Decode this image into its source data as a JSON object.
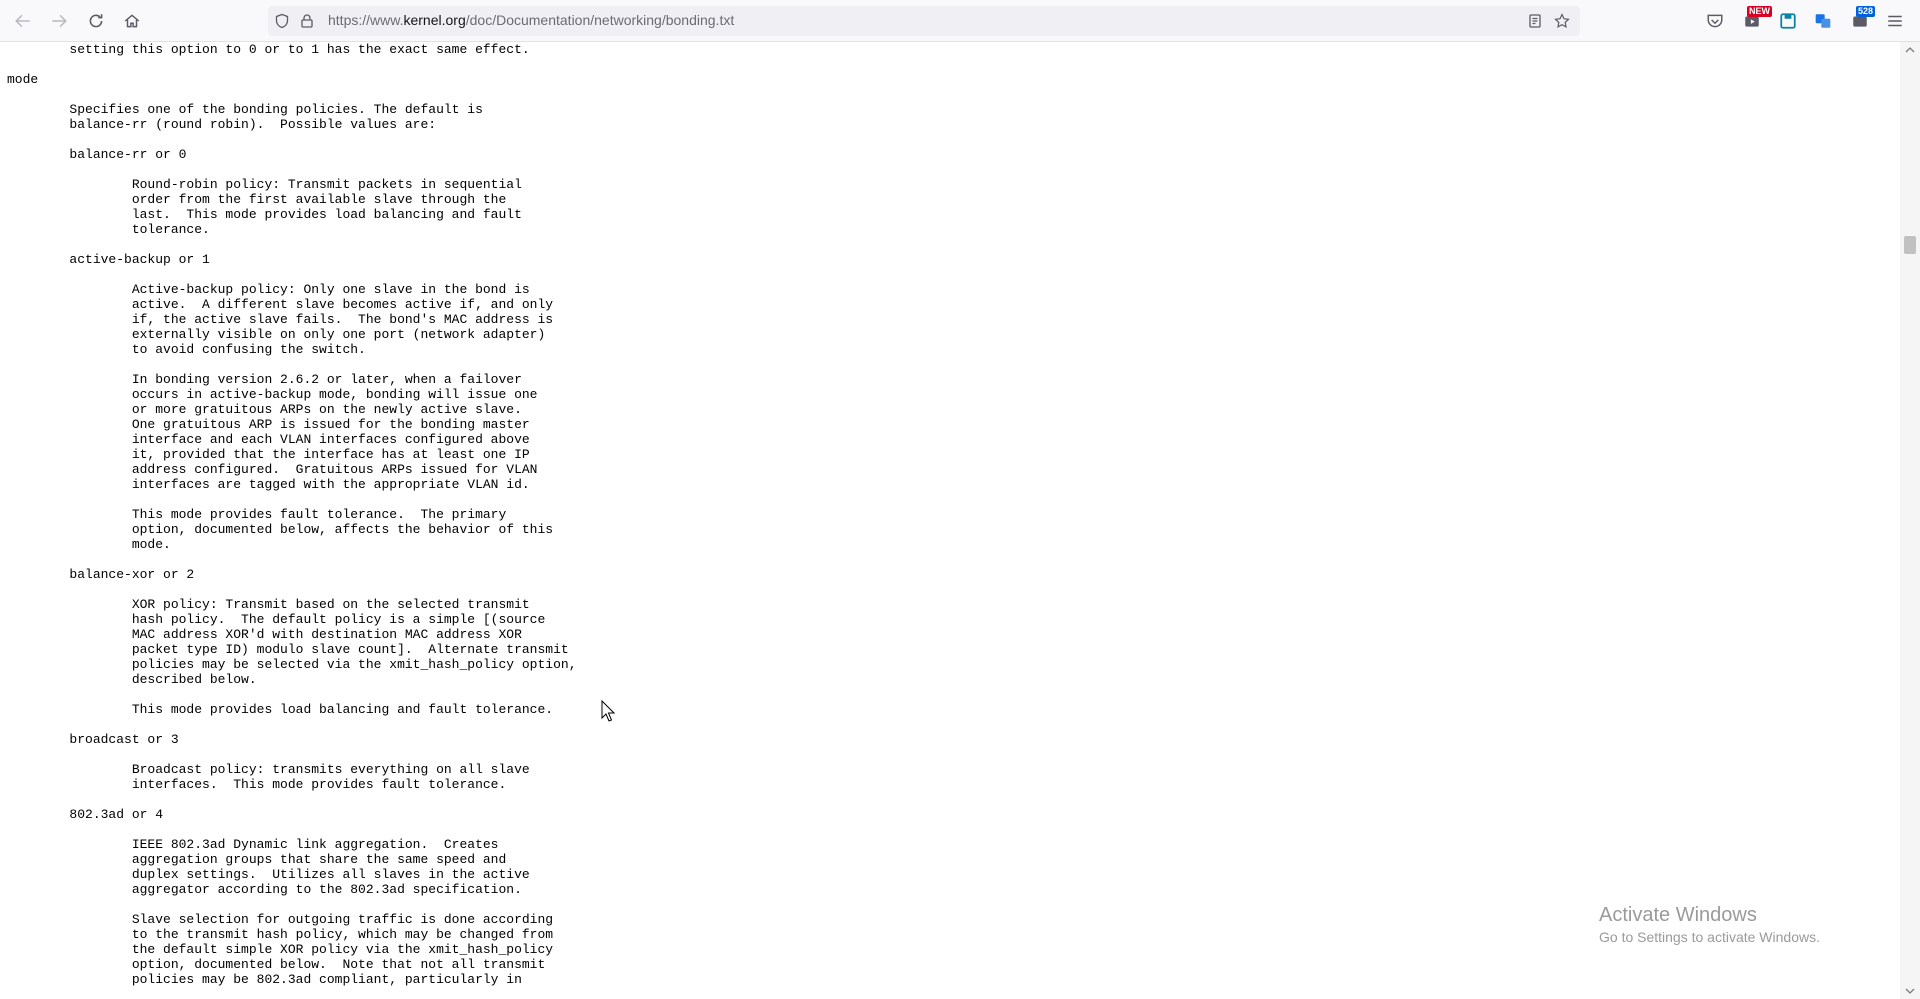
{
  "browser": {
    "url_prefix": "https://www.",
    "url_host": "kernel.org",
    "url_path": "/doc/Documentation/networking/bonding.txt",
    "badges": {
      "new": "NEW",
      "count": "528"
    },
    "colors": {
      "toolbar": "#f9f9fb",
      "urlbar": "#f0f0f4",
      "badge_red": "#d70022",
      "badge_blue": "#0060df"
    }
  },
  "document": {
    "lines": [
      "\tsetting this option to 0 or to 1 has the exact same effect.",
      "",
      "mode",
      "",
      "\tSpecifies one of the bonding policies. The default is",
      "\tbalance-rr (round robin).  Possible values are:",
      "",
      "\tbalance-rr or 0",
      "",
      "\t\tRound-robin policy: Transmit packets in sequential",
      "\t\torder from the first available slave through the",
      "\t\tlast.  This mode provides load balancing and fault",
      "\t\ttolerance.",
      "",
      "\tactive-backup or 1",
      "",
      "\t\tActive-backup policy: Only one slave in the bond is",
      "\t\tactive.  A different slave becomes active if, and only",
      "\t\tif, the active slave fails.  The bond's MAC address is",
      "\t\texternally visible on only one port (network adapter)",
      "\t\tto avoid confusing the switch.",
      "",
      "\t\tIn bonding version 2.6.2 or later, when a failover",
      "\t\toccurs in active-backup mode, bonding will issue one",
      "\t\tor more gratuitous ARPs on the newly active slave.",
      "\t\tOne gratuitous ARP is issued for the bonding master",
      "\t\tinterface and each VLAN interfaces configured above",
      "\t\tit, provided that the interface has at least one IP",
      "\t\taddress configured.  Gratuitous ARPs issued for VLAN",
      "\t\tinterfaces are tagged with the appropriate VLAN id.",
      "",
      "\t\tThis mode provides fault tolerance.  The primary",
      "\t\toption, documented below, affects the behavior of this",
      "\t\tmode.",
      "",
      "\tbalance-xor or 2",
      "",
      "\t\tXOR policy: Transmit based on the selected transmit",
      "\t\thash policy.  The default policy is a simple [(source",
      "\t\tMAC address XOR'd with destination MAC address XOR",
      "\t\tpacket type ID) modulo slave count].  Alternate transmit",
      "\t\tpolicies may be selected via the xmit_hash_policy option,",
      "\t\tdescribed below.",
      "",
      "\t\tThis mode provides load balancing and fault tolerance.",
      "",
      "\tbroadcast or 3",
      "",
      "\t\tBroadcast policy: transmits everything on all slave",
      "\t\tinterfaces.  This mode provides fault tolerance.",
      "",
      "\t802.3ad or 4",
      "",
      "\t\tIEEE 802.3ad Dynamic link aggregation.  Creates",
      "\t\taggregation groups that share the same speed and",
      "\t\tduplex settings.  Utilizes all slaves in the active",
      "\t\taggregator according to the 802.3ad specification.",
      "",
      "\t\tSlave selection for outgoing traffic is done according",
      "\t\tto the transmit hash policy, which may be changed from",
      "\t\tthe default simple XOR policy via the xmit_hash_policy",
      "\t\toption, documented below.  Note that not all transmit",
      "\t\tpolicies may be 802.3ad compliant, particularly in"
    ]
  },
  "overlay": {
    "watermark_title": "Activate Windows",
    "watermark_subtitle": "Go to Settings to activate Windows."
  }
}
